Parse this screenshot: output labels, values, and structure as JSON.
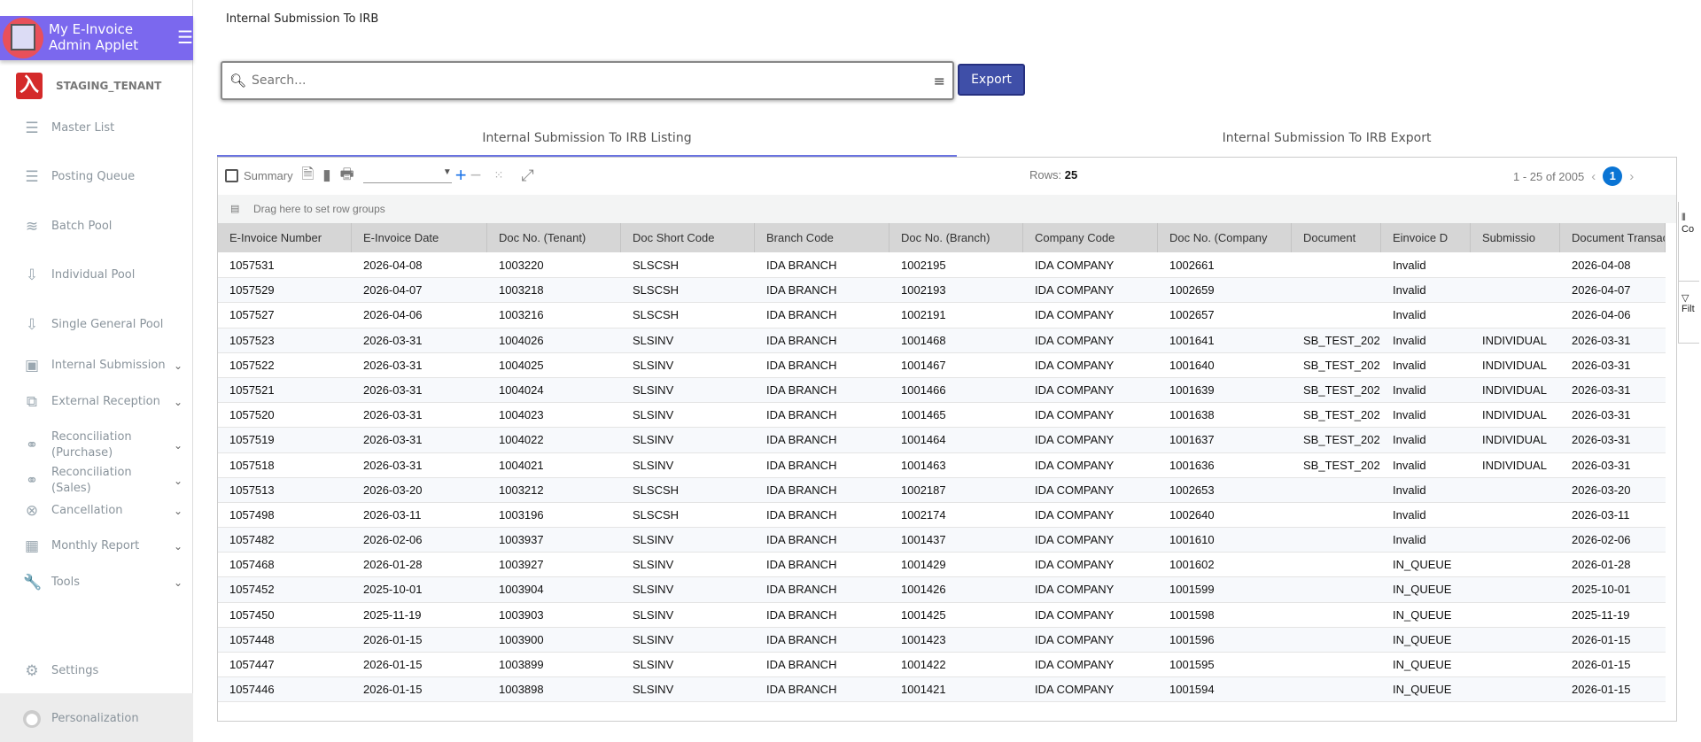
{
  "app": {
    "title_line1": "My E-Invoice",
    "title_line2": "Admin Applet",
    "tenant": "STAGING_TENANT"
  },
  "sidebar": {
    "items": [
      {
        "label": "Master List",
        "icon": "list-icon",
        "glyph": "☰"
      },
      {
        "label": "Posting Queue",
        "icon": "list-icon",
        "glyph": "☰"
      },
      {
        "label": "Batch Pool",
        "icon": "waves-icon",
        "glyph": "≋"
      },
      {
        "label": "Individual Pool",
        "icon": "inbox-download-icon",
        "glyph": "⇩"
      },
      {
        "label": "Single General Pool",
        "icon": "inbox-download-icon",
        "glyph": "⇩"
      },
      {
        "label": "Internal Submission",
        "icon": "calendar-refresh-icon",
        "glyph": "▣",
        "expandable": true
      },
      {
        "label": "External Reception",
        "icon": "external-link-icon",
        "glyph": "⧉",
        "expandable": true
      },
      {
        "label": "Reconciliation (Purchase)",
        "icon": "rings-icon",
        "glyph": "⚭",
        "expandable": true
      },
      {
        "label": "Reconciliation (Sales)",
        "icon": "rings-icon",
        "glyph": "⚭",
        "expandable": true
      },
      {
        "label": "Cancellation",
        "icon": "cancel-circle-icon",
        "glyph": "⊗",
        "expandable": true
      },
      {
        "label": "Monthly Report",
        "icon": "calendar-icon",
        "glyph": "▦",
        "expandable": true
      },
      {
        "label": "Tools",
        "icon": "wrench-icon",
        "glyph": "🔧",
        "expandable": true
      }
    ],
    "settings": "Settings",
    "personalization": "Personalization"
  },
  "page": {
    "title": "Internal Submission To IRB",
    "search_placeholder": "Search...",
    "export_label": "Export",
    "tabs": [
      "Internal Submission To IRB Listing",
      "Internal Submission To IRB Export"
    ]
  },
  "grid": {
    "summary_label": "Summary",
    "rows_label": "Rows:",
    "rows_value": "25",
    "pagination": "1 - 25 of 2005",
    "current_page": "1",
    "row_group_hint": "Drag here to set row groups",
    "side_columns": "Co",
    "side_filters": "Filt",
    "columns": [
      "E-Invoice Number",
      "E-Invoice Date",
      "Doc No. (Tenant)",
      "Doc Short Code",
      "Branch Code",
      "Doc No. (Branch)",
      "Company Code",
      "Doc No. (Company",
      "Document",
      "Einvoice D",
      "Submissio",
      "Document Transacti"
    ],
    "rows": [
      [
        "1057531",
        "2026-04-08",
        "1003220",
        "SLSCSH",
        "IDA BRANCH",
        "1002195",
        "IDA COMPANY",
        "1002661",
        "",
        "Invalid",
        "",
        "2026-04-08"
      ],
      [
        "1057529",
        "2026-04-07",
        "1003218",
        "SLSCSH",
        "IDA BRANCH",
        "1002193",
        "IDA COMPANY",
        "1002659",
        "",
        "Invalid",
        "",
        "2026-04-07"
      ],
      [
        "1057527",
        "2026-04-06",
        "1003216",
        "SLSCSH",
        "IDA BRANCH",
        "1002191",
        "IDA COMPANY",
        "1002657",
        "",
        "Invalid",
        "",
        "2026-04-06"
      ],
      [
        "1057523",
        "2026-03-31",
        "1004026",
        "SLSINV",
        "IDA BRANCH",
        "1001468",
        "IDA COMPANY",
        "1001641",
        "SB_TEST_202",
        "Invalid",
        "INDIVIDUAL",
        "2026-03-31"
      ],
      [
        "1057522",
        "2026-03-31",
        "1004025",
        "SLSINV",
        "IDA BRANCH",
        "1001467",
        "IDA COMPANY",
        "1001640",
        "SB_TEST_202",
        "Invalid",
        "INDIVIDUAL",
        "2026-03-31"
      ],
      [
        "1057521",
        "2026-03-31",
        "1004024",
        "SLSINV",
        "IDA BRANCH",
        "1001466",
        "IDA COMPANY",
        "1001639",
        "SB_TEST_202",
        "Invalid",
        "INDIVIDUAL",
        "2026-03-31"
      ],
      [
        "1057520",
        "2026-03-31",
        "1004023",
        "SLSINV",
        "IDA BRANCH",
        "1001465",
        "IDA COMPANY",
        "1001638",
        "SB_TEST_202",
        "Invalid",
        "INDIVIDUAL",
        "2026-03-31"
      ],
      [
        "1057519",
        "2026-03-31",
        "1004022",
        "SLSINV",
        "IDA BRANCH",
        "1001464",
        "IDA COMPANY",
        "1001637",
        "SB_TEST_202",
        "Invalid",
        "INDIVIDUAL",
        "2026-03-31"
      ],
      [
        "1057518",
        "2026-03-31",
        "1004021",
        "SLSINV",
        "IDA BRANCH",
        "1001463",
        "IDA COMPANY",
        "1001636",
        "SB_TEST_202",
        "Invalid",
        "INDIVIDUAL",
        "2026-03-31"
      ],
      [
        "1057513",
        "2026-03-20",
        "1003212",
        "SLSCSH",
        "IDA BRANCH",
        "1002187",
        "IDA COMPANY",
        "1002653",
        "",
        "Invalid",
        "",
        "2026-03-20"
      ],
      [
        "1057498",
        "2026-03-11",
        "1003196",
        "SLSCSH",
        "IDA BRANCH",
        "1002174",
        "IDA COMPANY",
        "1002640",
        "",
        "Invalid",
        "",
        "2026-03-11"
      ],
      [
        "1057482",
        "2026-02-06",
        "1003937",
        "SLSINV",
        "IDA BRANCH",
        "1001437",
        "IDA COMPANY",
        "1001610",
        "",
        "Invalid",
        "",
        "2026-02-06"
      ],
      [
        "1057468",
        "2026-01-28",
        "1003927",
        "SLSINV",
        "IDA BRANCH",
        "1001429",
        "IDA COMPANY",
        "1001602",
        "",
        "IN_QUEUE",
        "",
        "2026-01-28"
      ],
      [
        "1057452",
        "2025-10-01",
        "1003904",
        "SLSINV",
        "IDA BRANCH",
        "1001426",
        "IDA COMPANY",
        "1001599",
        "",
        "IN_QUEUE",
        "",
        "2025-10-01"
      ],
      [
        "1057450",
        "2025-11-19",
        "1003903",
        "SLSINV",
        "IDA BRANCH",
        "1001425",
        "IDA COMPANY",
        "1001598",
        "",
        "IN_QUEUE",
        "",
        "2025-11-19"
      ],
      [
        "1057448",
        "2026-01-15",
        "1003900",
        "SLSINV",
        "IDA BRANCH",
        "1001423",
        "IDA COMPANY",
        "1001596",
        "",
        "IN_QUEUE",
        "",
        "2026-01-15"
      ],
      [
        "1057447",
        "2026-01-15",
        "1003899",
        "SLSINV",
        "IDA BRANCH",
        "1001422",
        "IDA COMPANY",
        "1001595",
        "",
        "IN_QUEUE",
        "",
        "2026-01-15"
      ],
      [
        "1057446",
        "2026-01-15",
        "1003898",
        "SLSINV",
        "IDA BRANCH",
        "1001421",
        "IDA COMPANY",
        "1001594",
        "",
        "IN_QUEUE",
        "",
        "2026-01-15"
      ]
    ]
  },
  "colors": {
    "brand": "#7b68ee",
    "export": "#3f4fa8",
    "page_badge": "#0a74d4"
  }
}
